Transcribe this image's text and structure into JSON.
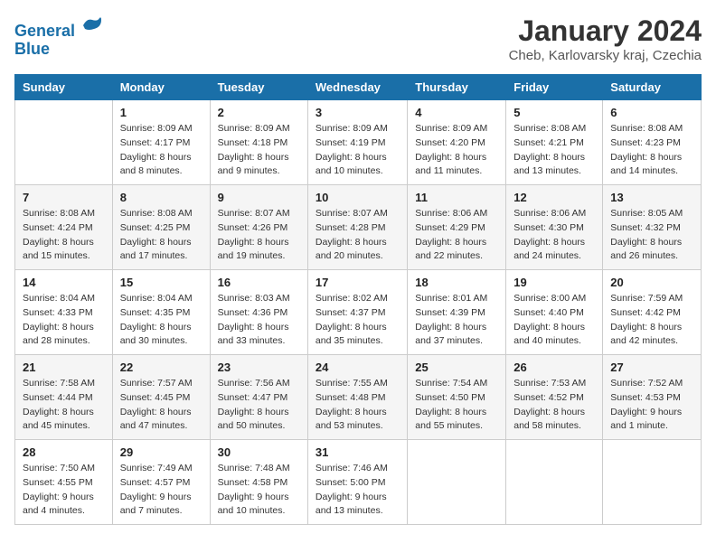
{
  "logo": {
    "line1": "General",
    "line2": "Blue"
  },
  "title": "January 2024",
  "subtitle": "Cheb, Karlovarsky kraj, Czechia",
  "weekdays": [
    "Sunday",
    "Monday",
    "Tuesday",
    "Wednesday",
    "Thursday",
    "Friday",
    "Saturday"
  ],
  "weeks": [
    [
      {
        "day": "",
        "sunrise": "",
        "sunset": "",
        "daylight": ""
      },
      {
        "day": "1",
        "sunrise": "Sunrise: 8:09 AM",
        "sunset": "Sunset: 4:17 PM",
        "daylight": "Daylight: 8 hours and 8 minutes."
      },
      {
        "day": "2",
        "sunrise": "Sunrise: 8:09 AM",
        "sunset": "Sunset: 4:18 PM",
        "daylight": "Daylight: 8 hours and 9 minutes."
      },
      {
        "day": "3",
        "sunrise": "Sunrise: 8:09 AM",
        "sunset": "Sunset: 4:19 PM",
        "daylight": "Daylight: 8 hours and 10 minutes."
      },
      {
        "day": "4",
        "sunrise": "Sunrise: 8:09 AM",
        "sunset": "Sunset: 4:20 PM",
        "daylight": "Daylight: 8 hours and 11 minutes."
      },
      {
        "day": "5",
        "sunrise": "Sunrise: 8:08 AM",
        "sunset": "Sunset: 4:21 PM",
        "daylight": "Daylight: 8 hours and 13 minutes."
      },
      {
        "day": "6",
        "sunrise": "Sunrise: 8:08 AM",
        "sunset": "Sunset: 4:23 PM",
        "daylight": "Daylight: 8 hours and 14 minutes."
      }
    ],
    [
      {
        "day": "7",
        "sunrise": "Sunrise: 8:08 AM",
        "sunset": "Sunset: 4:24 PM",
        "daylight": "Daylight: 8 hours and 15 minutes."
      },
      {
        "day": "8",
        "sunrise": "Sunrise: 8:08 AM",
        "sunset": "Sunset: 4:25 PM",
        "daylight": "Daylight: 8 hours and 17 minutes."
      },
      {
        "day": "9",
        "sunrise": "Sunrise: 8:07 AM",
        "sunset": "Sunset: 4:26 PM",
        "daylight": "Daylight: 8 hours and 19 minutes."
      },
      {
        "day": "10",
        "sunrise": "Sunrise: 8:07 AM",
        "sunset": "Sunset: 4:28 PM",
        "daylight": "Daylight: 8 hours and 20 minutes."
      },
      {
        "day": "11",
        "sunrise": "Sunrise: 8:06 AM",
        "sunset": "Sunset: 4:29 PM",
        "daylight": "Daylight: 8 hours and 22 minutes."
      },
      {
        "day": "12",
        "sunrise": "Sunrise: 8:06 AM",
        "sunset": "Sunset: 4:30 PM",
        "daylight": "Daylight: 8 hours and 24 minutes."
      },
      {
        "day": "13",
        "sunrise": "Sunrise: 8:05 AM",
        "sunset": "Sunset: 4:32 PM",
        "daylight": "Daylight: 8 hours and 26 minutes."
      }
    ],
    [
      {
        "day": "14",
        "sunrise": "Sunrise: 8:04 AM",
        "sunset": "Sunset: 4:33 PM",
        "daylight": "Daylight: 8 hours and 28 minutes."
      },
      {
        "day": "15",
        "sunrise": "Sunrise: 8:04 AM",
        "sunset": "Sunset: 4:35 PM",
        "daylight": "Daylight: 8 hours and 30 minutes."
      },
      {
        "day": "16",
        "sunrise": "Sunrise: 8:03 AM",
        "sunset": "Sunset: 4:36 PM",
        "daylight": "Daylight: 8 hours and 33 minutes."
      },
      {
        "day": "17",
        "sunrise": "Sunrise: 8:02 AM",
        "sunset": "Sunset: 4:37 PM",
        "daylight": "Daylight: 8 hours and 35 minutes."
      },
      {
        "day": "18",
        "sunrise": "Sunrise: 8:01 AM",
        "sunset": "Sunset: 4:39 PM",
        "daylight": "Daylight: 8 hours and 37 minutes."
      },
      {
        "day": "19",
        "sunrise": "Sunrise: 8:00 AM",
        "sunset": "Sunset: 4:40 PM",
        "daylight": "Daylight: 8 hours and 40 minutes."
      },
      {
        "day": "20",
        "sunrise": "Sunrise: 7:59 AM",
        "sunset": "Sunset: 4:42 PM",
        "daylight": "Daylight: 8 hours and 42 minutes."
      }
    ],
    [
      {
        "day": "21",
        "sunrise": "Sunrise: 7:58 AM",
        "sunset": "Sunset: 4:44 PM",
        "daylight": "Daylight: 8 hours and 45 minutes."
      },
      {
        "day": "22",
        "sunrise": "Sunrise: 7:57 AM",
        "sunset": "Sunset: 4:45 PM",
        "daylight": "Daylight: 8 hours and 47 minutes."
      },
      {
        "day": "23",
        "sunrise": "Sunrise: 7:56 AM",
        "sunset": "Sunset: 4:47 PM",
        "daylight": "Daylight: 8 hours and 50 minutes."
      },
      {
        "day": "24",
        "sunrise": "Sunrise: 7:55 AM",
        "sunset": "Sunset: 4:48 PM",
        "daylight": "Daylight: 8 hours and 53 minutes."
      },
      {
        "day": "25",
        "sunrise": "Sunrise: 7:54 AM",
        "sunset": "Sunset: 4:50 PM",
        "daylight": "Daylight: 8 hours and 55 minutes."
      },
      {
        "day": "26",
        "sunrise": "Sunrise: 7:53 AM",
        "sunset": "Sunset: 4:52 PM",
        "daylight": "Daylight: 8 hours and 58 minutes."
      },
      {
        "day": "27",
        "sunrise": "Sunrise: 7:52 AM",
        "sunset": "Sunset: 4:53 PM",
        "daylight": "Daylight: 9 hours and 1 minute."
      }
    ],
    [
      {
        "day": "28",
        "sunrise": "Sunrise: 7:50 AM",
        "sunset": "Sunset: 4:55 PM",
        "daylight": "Daylight: 9 hours and 4 minutes."
      },
      {
        "day": "29",
        "sunrise": "Sunrise: 7:49 AM",
        "sunset": "Sunset: 4:57 PM",
        "daylight": "Daylight: 9 hours and 7 minutes."
      },
      {
        "day": "30",
        "sunrise": "Sunrise: 7:48 AM",
        "sunset": "Sunset: 4:58 PM",
        "daylight": "Daylight: 9 hours and 10 minutes."
      },
      {
        "day": "31",
        "sunrise": "Sunrise: 7:46 AM",
        "sunset": "Sunset: 5:00 PM",
        "daylight": "Daylight: 9 hours and 13 minutes."
      },
      {
        "day": "",
        "sunrise": "",
        "sunset": "",
        "daylight": ""
      },
      {
        "day": "",
        "sunrise": "",
        "sunset": "",
        "daylight": ""
      },
      {
        "day": "",
        "sunrise": "",
        "sunset": "",
        "daylight": ""
      }
    ]
  ]
}
